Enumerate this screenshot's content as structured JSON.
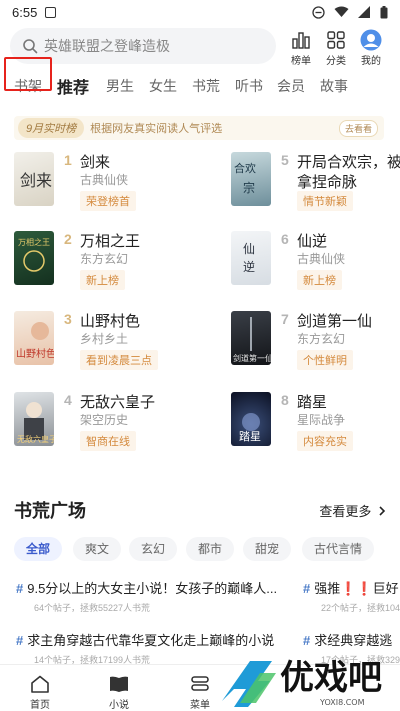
{
  "status": {
    "time": "6:55"
  },
  "search": {
    "placeholder": "英雄联盟之登峰造极"
  },
  "top_icons": {
    "rank_label": "榜单",
    "category_label": "分类",
    "mine_label": "我的"
  },
  "tabs": [
    "书架",
    "推荐",
    "男生",
    "女生",
    "书荒",
    "听书",
    "会员",
    "故事"
  ],
  "active_tab": "推荐",
  "highlighted_tab": "书架",
  "banner": {
    "tag": "9月实时榜",
    "desc": "根据网友真实阅读人气评选",
    "btn": "去看看"
  },
  "books": [
    {
      "rank": "1",
      "title": "剑来",
      "genre": "古典仙侠",
      "badge": "荣登榜首"
    },
    {
      "rank": "2",
      "title": "万相之王",
      "genre": "东方玄幻",
      "badge": "新上榜"
    },
    {
      "rank": "3",
      "title": "山野村色",
      "genre": "乡村乡土",
      "badge": "看到凌晨三点"
    },
    {
      "rank": "4",
      "title": "无敌六皇子",
      "genre": "架空历史",
      "badge": "智商在线"
    },
    {
      "rank": "5",
      "title": "开局合欢宗，被",
      "title2": "拿捏命脉",
      "badge": "情节新颖"
    },
    {
      "rank": "6",
      "title": "仙逆",
      "genre": "古典仙侠",
      "badge": "新上榜"
    },
    {
      "rank": "7",
      "title": "剑道第一仙",
      "genre": "东方玄幻",
      "badge": "个性鲜明"
    },
    {
      "rank": "8",
      "title": "踏星",
      "genre": "星际战争",
      "badge": "内容充实"
    }
  ],
  "section": {
    "title": "书荒广场",
    "more": "查看更多"
  },
  "chips": [
    "全部",
    "爽文",
    "玄幻",
    "都市",
    "甜宠",
    "古代言情"
  ],
  "posts": [
    {
      "title": "9.5分以上的大女主小说！女孩子的巅峰人...",
      "meta": "64个帖子，拯救55227人书荒"
    },
    {
      "title": "强推❗❗巨好",
      "meta": "22个帖子，拯救104"
    },
    {
      "title": "求主角穿越古代靠华夏文化走上巅峰的小说",
      "meta": "14个帖子，拯救17199人书荒"
    },
    {
      "title": "求经典穿越逃",
      "meta": "17个帖子，拯救329"
    }
  ],
  "nav": {
    "home": "首页",
    "novel": "小说",
    "menu": "菜单"
  },
  "watermark": {
    "text": "优戏吧",
    "sub": "YOXI8.COM"
  },
  "colors": {
    "accent": "#3b5bcc",
    "highlight_border": "#e6231c",
    "gold": "#d8b77e",
    "badge_text": "#d48a3d"
  }
}
